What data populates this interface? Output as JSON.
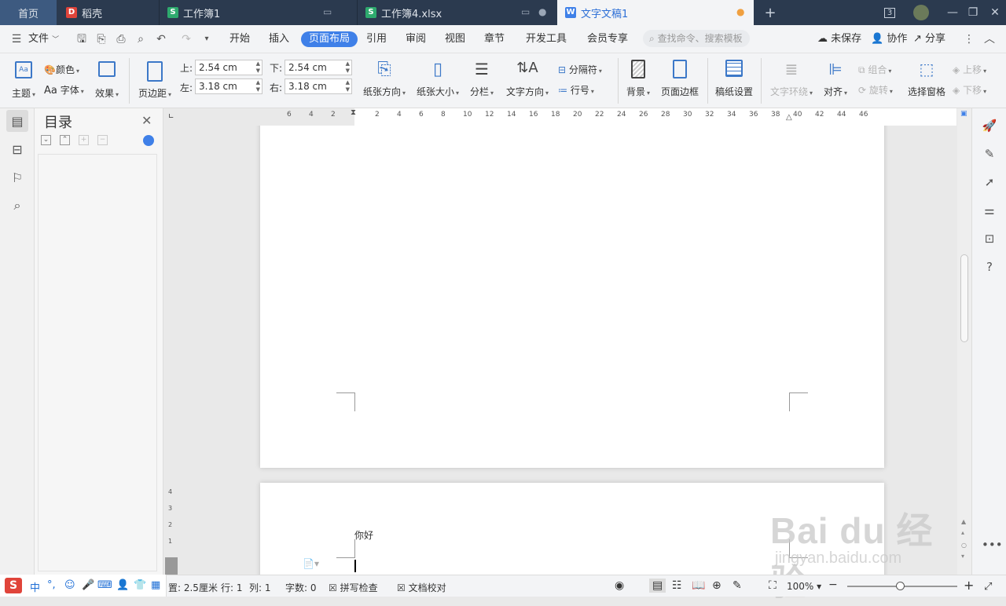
{
  "tabs": {
    "home": "首页",
    "tab1": "稻壳",
    "tab2": "工作簿1",
    "tab3": "工作簿4.xlsx",
    "tab4": "文字文稿1",
    "new_tab": "+",
    "badge": "3"
  },
  "menu": {
    "file": "文件",
    "items": [
      "开始",
      "插入",
      "页面布局",
      "引用",
      "审阅",
      "视图",
      "章节",
      "开发工具",
      "会员专享"
    ],
    "search_placeholder": "查找命令、搜索模板",
    "unsaved": "未保存",
    "collab": "协作",
    "share": "分享"
  },
  "ribbon": {
    "theme": "主题",
    "colors": "颜色",
    "font": "字体",
    "effects": "效果",
    "margins": "页边距",
    "top_label": "上:",
    "top_value": "2.54 cm",
    "bottom_label": "下:",
    "bottom_value": "2.54 cm",
    "left_label": "左:",
    "left_value": "3.18 cm",
    "right_label": "右:",
    "right_value": "3.18 cm",
    "orientation": "纸张方向",
    "size": "纸张大小",
    "columns": "分栏",
    "text_direction": "文字方向",
    "breaks": "分隔符",
    "line_numbers": "行号",
    "background": "背景",
    "page_border": "页面边框",
    "manuscript": "稿纸设置",
    "wrap_text": "文字环绕",
    "align": "对齐",
    "group": "组合",
    "rotate": "旋转",
    "selection_pane": "选择窗格",
    "bring_forward": "上移",
    "send_backward": "下移"
  },
  "toc": {
    "title": "目录",
    "buttons": [
      "⌄",
      "⌃",
      "+",
      "−"
    ]
  },
  "ruler": {
    "h_ticks": [
      "6",
      "4",
      "2",
      "2",
      "4",
      "6",
      "8",
      "10",
      "12",
      "14",
      "16",
      "18",
      "20",
      "22",
      "24",
      "26",
      "28",
      "30",
      "32",
      "34",
      "36",
      "38",
      "40",
      "42",
      "44",
      "46"
    ],
    "v_ticks": [
      "4",
      "3",
      "2",
      "1"
    ]
  },
  "document": {
    "text": "你好"
  },
  "status": {
    "position": "置: 2.5厘米",
    "row": "行: 1",
    "col": "列: 1",
    "word_count": "字数: 0",
    "spell_check": "拼写检查",
    "doc_review": "文档校对",
    "zoom": "100%"
  },
  "ime": {
    "mode": "中",
    "punct": "°,"
  },
  "watermark": {
    "main": "Bai du 经验",
    "sub": "jingyan.baidu.com"
  },
  "colors": {
    "tabbar_bg": "#2b3a4f",
    "accent": "#3f80e8",
    "wps_red": "#e0443a",
    "sheet_green": "#2eaa6e",
    "writer_blue": "#3f80e8"
  }
}
